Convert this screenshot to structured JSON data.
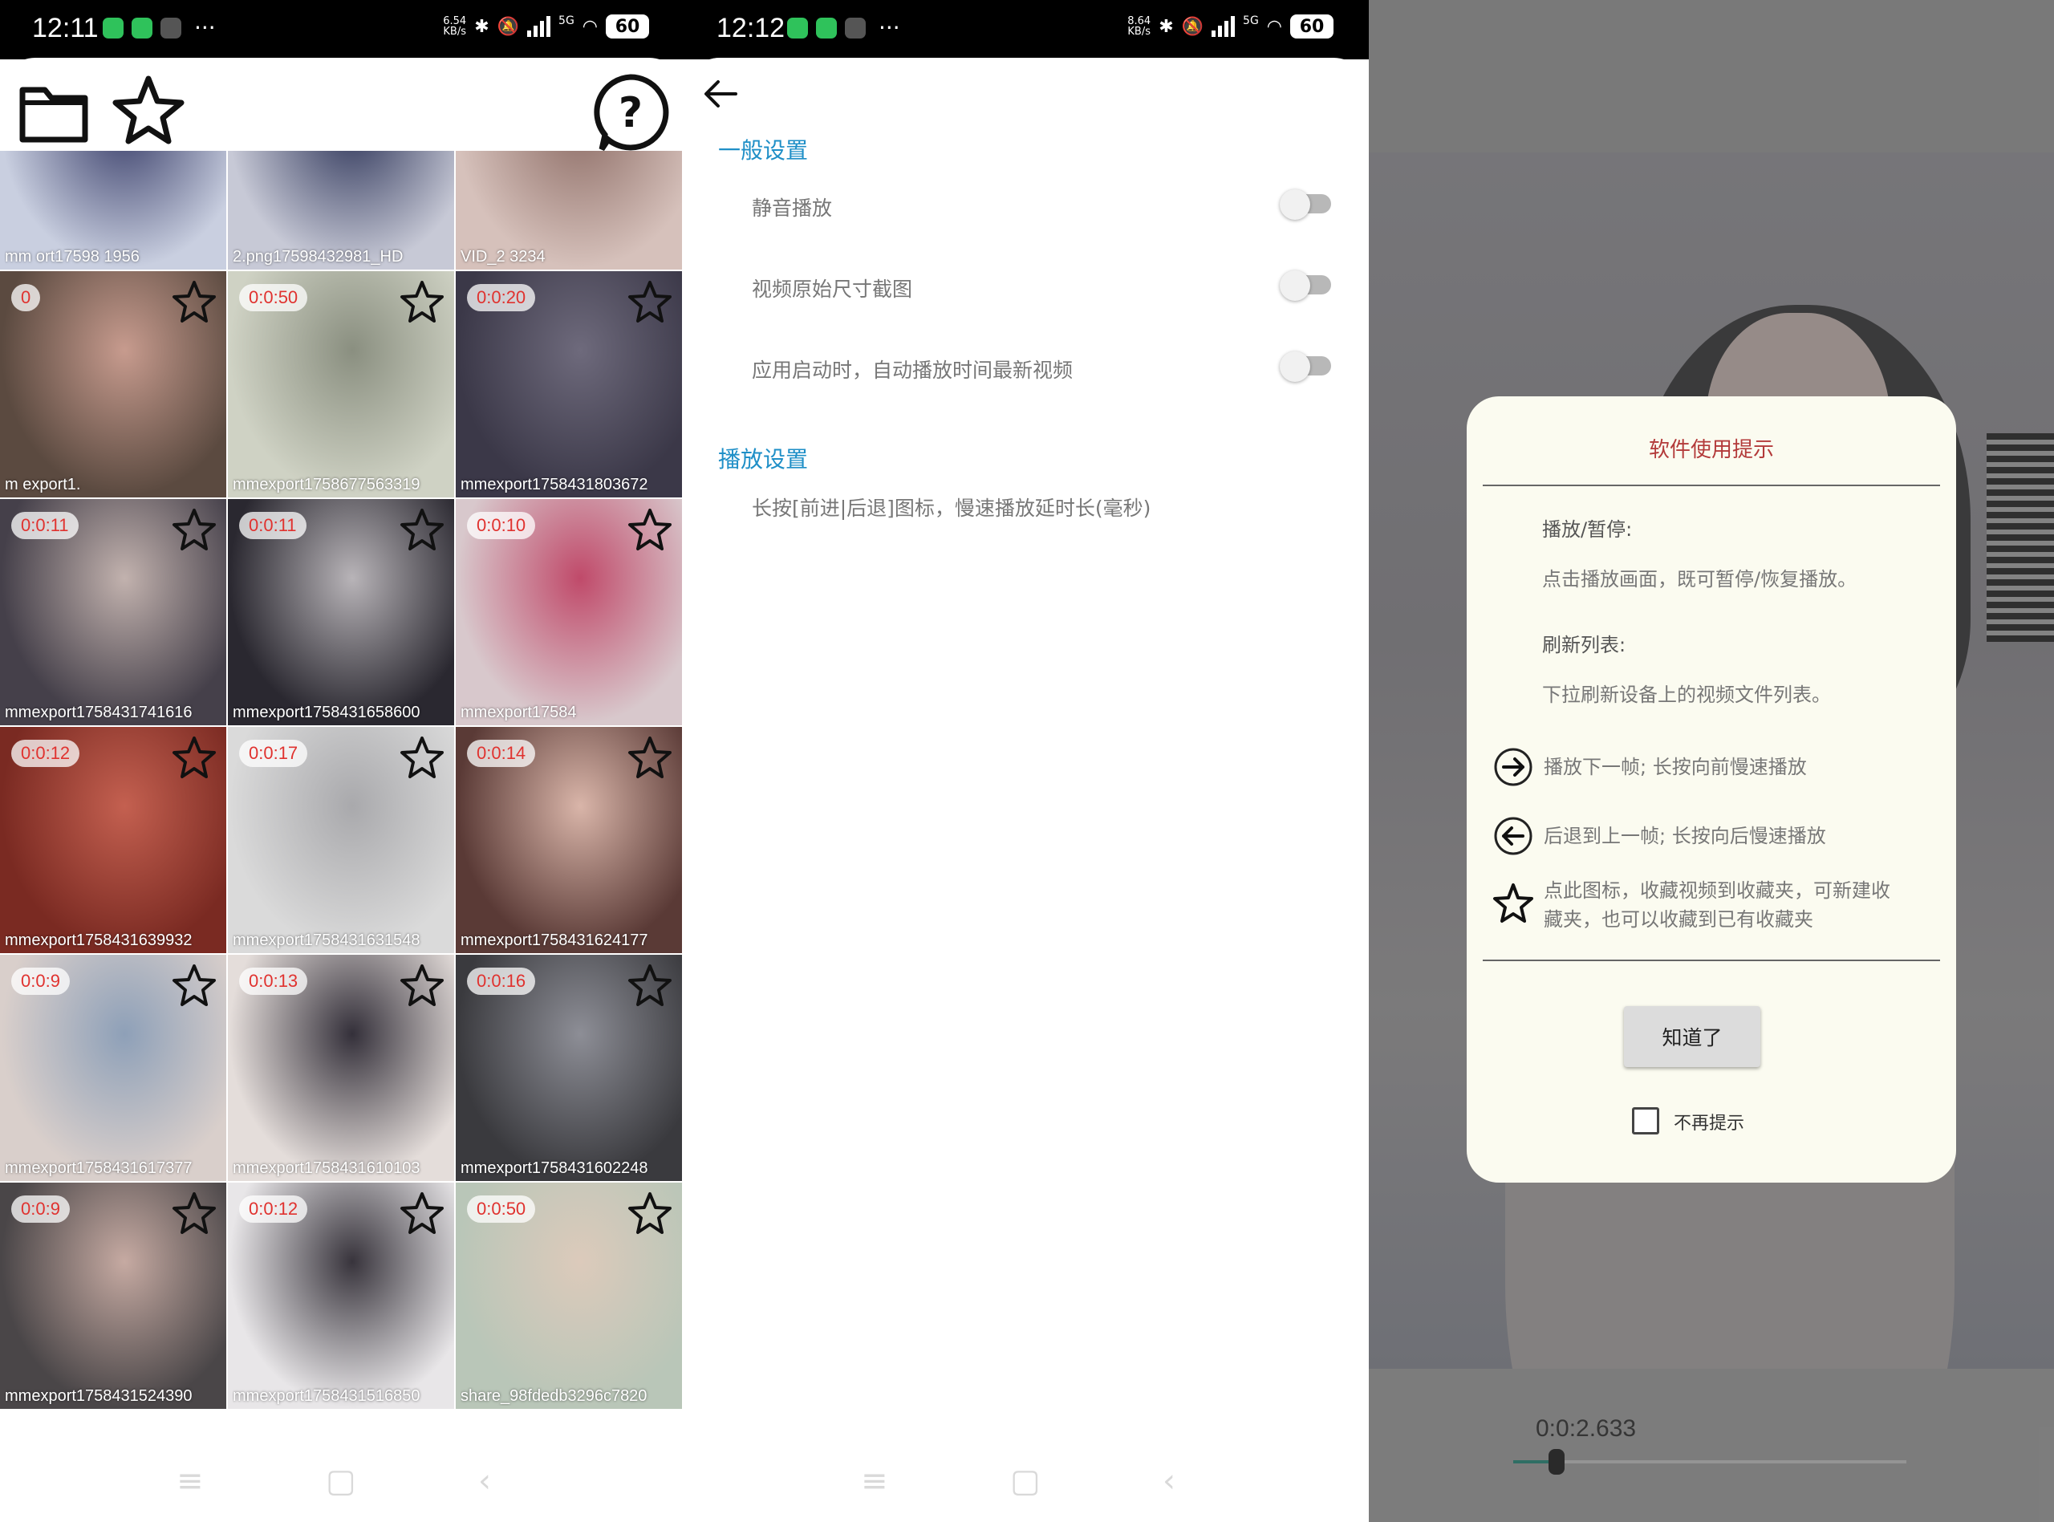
{
  "panel1": {
    "status": {
      "time": "12:11",
      "speed": "6.54\nKB/s",
      "network": "5G",
      "battery": "60"
    },
    "tiles": [
      {
        "duration": "",
        "filename": "mm  ort17598   1956",
        "starred": false
      },
      {
        "duration": "",
        "filename": "2.png17598432981_HD",
        "starred": false
      },
      {
        "duration": "",
        "filename": "VID_2           3234",
        "starred": false
      },
      {
        "duration": "0",
        "filename": "m  export1.",
        "starred": true
      },
      {
        "duration": "0:0:50",
        "filename": "mmexport1758677563319",
        "starred": true
      },
      {
        "duration": "0:0:20",
        "filename": "mmexport1758431803672",
        "starred": true
      },
      {
        "duration": "0:0:11",
        "filename": "mmexport1758431741616",
        "starred": true
      },
      {
        "duration": "0:0:11",
        "filename": "mmexport1758431658600",
        "starred": true
      },
      {
        "duration": "0:0:10",
        "filename": "mmexport17584",
        "starred": true
      },
      {
        "duration": "0:0:12",
        "filename": "mmexport1758431639932",
        "starred": true
      },
      {
        "duration": "0:0:17",
        "filename": "mmexport1758431631548",
        "starred": true
      },
      {
        "duration": "0:0:14",
        "filename": "mmexport1758431624177",
        "starred": true
      },
      {
        "duration": "0:0:9",
        "filename": "mmexport1758431617377",
        "starred": true
      },
      {
        "duration": "0:0:13",
        "filename": "mmexport1758431610103",
        "starred": true
      },
      {
        "duration": "0:0:16",
        "filename": "mmexport1758431602248",
        "starred": true
      },
      {
        "duration": "0:0:9",
        "filename": "mmexport1758431524390",
        "starred": true
      },
      {
        "duration": "0:0:12",
        "filename": "mmexport1758431516850",
        "starred": true
      },
      {
        "duration": "0:0:50",
        "filename": "share_98fdedb3296c7820",
        "starred": true
      }
    ]
  },
  "panel2": {
    "status": {
      "time": "12:12",
      "speed": "8.64\nKB/s",
      "network": "5G",
      "battery": "60"
    },
    "general_title": "一般设置",
    "settings": [
      {
        "label": "静音播放",
        "on": false
      },
      {
        "label": "视频原始尺寸截图",
        "on": false
      },
      {
        "label": "应用启动时，自动播放时间最新视频",
        "on": false
      }
    ],
    "play_title": "播放设置",
    "play_item": "长按[前进|后退]图标，慢速播放延时长(毫秒)"
  },
  "panel3": {
    "dialog": {
      "title": "软件使用提示",
      "play_pause_head": "播放/暂停:",
      "play_pause_text": "点击播放画面，既可暂停/恢复播放。",
      "refresh_head": "刷新列表:",
      "refresh_text": "下拉刷新设备上的视频文件列表。",
      "next_text": "播放下一帧; 长按向前慢速播放",
      "prev_text": "后退到上一帧; 长按向后慢速播放",
      "star_text_1": "点此图标，收藏视频到收藏夹，可新建收",
      "star_text_2": "藏夹，也可以收藏到已有收藏夹",
      "ok": "知道了",
      "dont_show": "不再提示"
    },
    "time": "0:0:2.633",
    "progress": 0.11
  },
  "colors": {
    "accent_blue": "#1f8fc7",
    "duration_red": "#e0322f",
    "dialog_title_red": "#b33a3a",
    "seek_green": "#1a7a6a"
  }
}
